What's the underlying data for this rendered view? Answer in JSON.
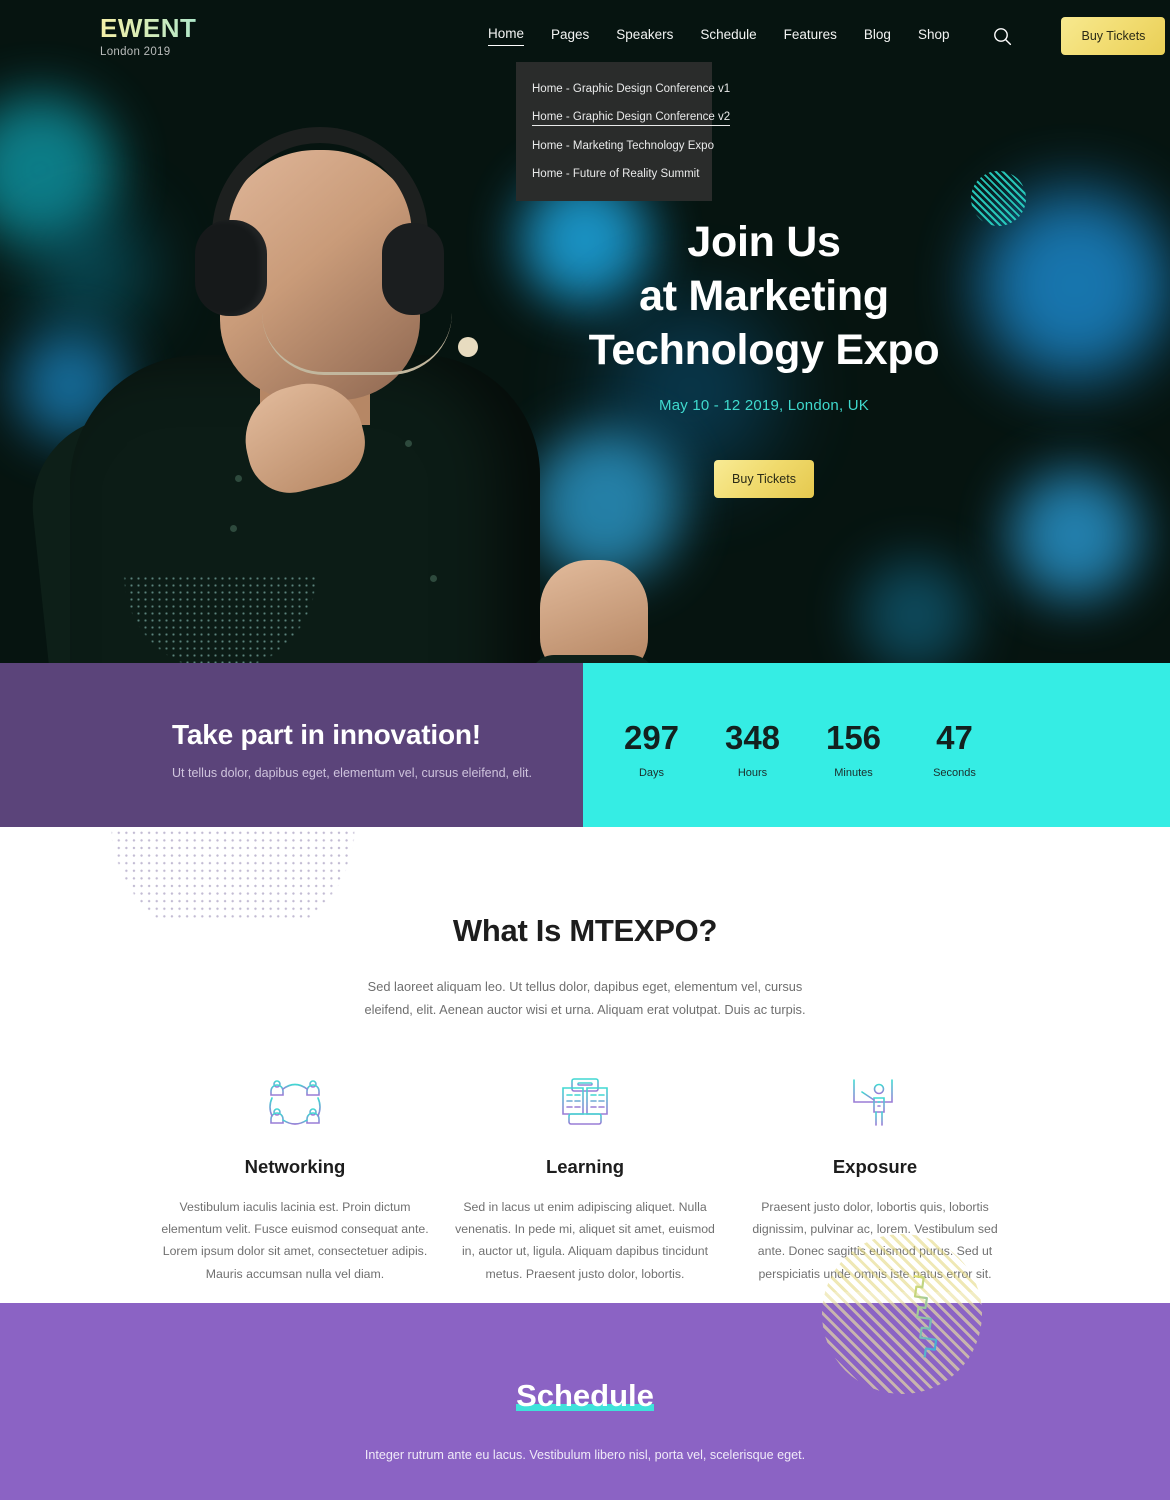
{
  "header": {
    "logo": "EWENT",
    "logo_sub": "London 2019",
    "nav": [
      {
        "label": "Home",
        "active": true
      },
      {
        "label": "Pages",
        "active": false
      },
      {
        "label": "Speakers",
        "active": false
      },
      {
        "label": "Schedule",
        "active": false
      },
      {
        "label": "Features",
        "active": false
      },
      {
        "label": "Blog",
        "active": false
      },
      {
        "label": "Shop",
        "active": false
      }
    ],
    "search_icon": "search-icon",
    "buy_tickets": "Buy Tickets"
  },
  "dropdown": {
    "items": [
      {
        "label": "Home - Graphic Design Conference v1",
        "hover": false
      },
      {
        "label": "Home - Graphic Design Conference v2",
        "hover": true
      },
      {
        "label": "Home - Marketing Technology Expo",
        "hover": false
      },
      {
        "label": "Home - Future of Reality Summit",
        "hover": false
      }
    ]
  },
  "hero": {
    "title_line1": "Join Us",
    "title_line2": "at Marketing",
    "title_line3": "Technology Expo",
    "subtitle": "May 10 - 12 2019, London, UK",
    "cta": "Buy Tickets"
  },
  "band": {
    "title": "Take part in innovation!",
    "subtitle": "Ut tellus dolor, dapibus eget, elementum vel, cursus eleifend, elit.",
    "countdown": [
      {
        "value": "297",
        "label": "Days"
      },
      {
        "value": "348",
        "label": "Hours"
      },
      {
        "value": "156",
        "label": "Minutes"
      },
      {
        "value": "47",
        "label": "Seconds"
      }
    ]
  },
  "about": {
    "title": "What Is MTEXPO?",
    "description": "Sed laoreet aliquam leo. Ut tellus dolor, dapibus eget, elementum vel, cursus eleifend, elit. Aenean auctor wisi et urna. Aliquam erat volutpat. Duis ac turpis.",
    "features": [
      {
        "icon": "networking-icon",
        "title": "Networking",
        "text": "Vestibulum iaculis lacinia est. Proin dictum elementum velit. Fusce euismod consequat ante. Lorem ipsum dolor sit amet, consectetuer adipis. Mauris accumsan nulla vel diam."
      },
      {
        "icon": "learning-icon",
        "title": "Learning",
        "text": "Sed in lacus ut enim adipiscing aliquet. Nulla venenatis. In pede mi, aliquet sit amet, euismod in, auctor ut, ligula. Aliquam dapibus tincidunt metus. Praesent justo dolor, lobortis."
      },
      {
        "icon": "exposure-icon",
        "title": "Exposure",
        "text": "Praesent justo dolor, lobortis quis, lobortis dignissim, pulvinar ac, lorem. Vestibulum sed ante. Donec sagittis euismod purus. Sed ut perspiciatis unde omnis iste natus error sit."
      }
    ]
  },
  "schedule": {
    "title": "Schedule",
    "description": "Integer rutrum ante eu lacus. Vestibulum libero nisl, porta vel, scelerisque eget."
  },
  "colors": {
    "cyan": "#35ede4",
    "dark_purple": "#5b447a",
    "purple": "#8b63c4",
    "gold": "#f0da6c",
    "hero_bg": "#061410"
  }
}
